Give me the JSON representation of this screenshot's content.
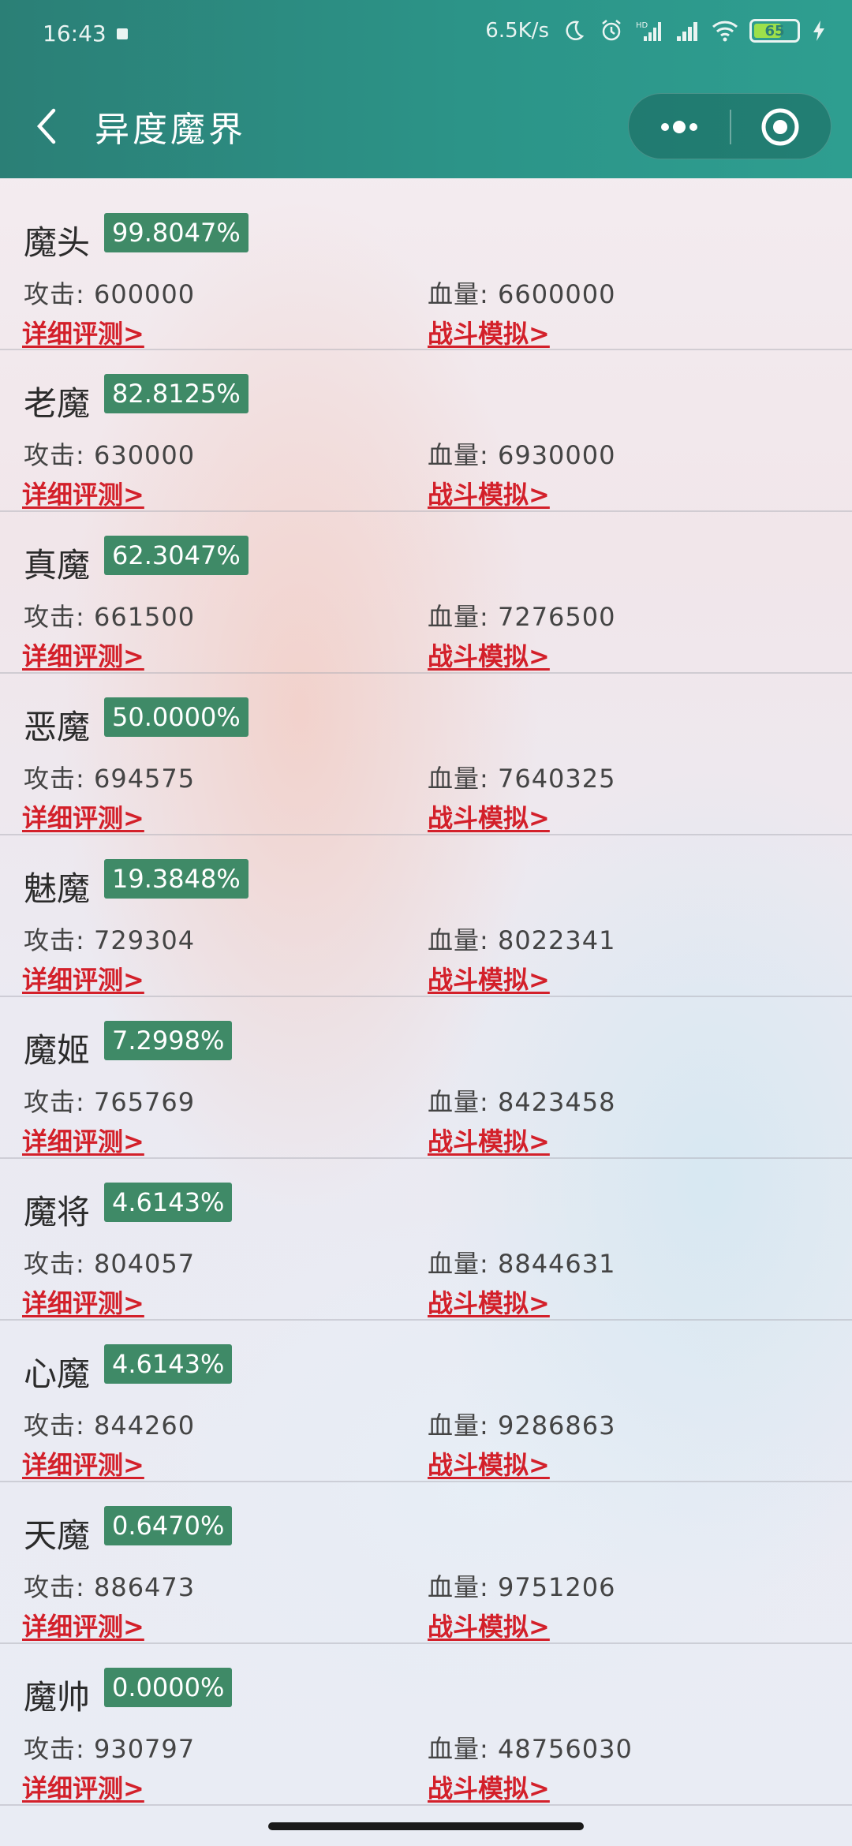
{
  "status_bar": {
    "time": "16:43",
    "network_speed": "6.5K/s",
    "battery_level": "65",
    "battery_fraction": 0.65,
    "icons": [
      "moon-icon",
      "alarm-icon",
      "hd-signal-icon",
      "signal-icon",
      "wifi-icon",
      "battery-icon",
      "charging-icon"
    ]
  },
  "header": {
    "title": "异度魔界",
    "back_icon": "chevron-left-icon",
    "more_icon": "more-dots-icon",
    "close_icon": "target-circle-icon"
  },
  "labels": {
    "attack": "攻击: ",
    "hp": "血量: ",
    "detail": "详细评测>",
    "battle": "战斗模拟>"
  },
  "colors": {
    "header": "#2c9488",
    "badge": "#3f8a67",
    "link": "#d3202a"
  },
  "monsters": [
    {
      "name": "魔头",
      "rate": "99.8047%",
      "attack": "600000",
      "hp": "6600000"
    },
    {
      "name": "老魔",
      "rate": "82.8125%",
      "attack": "630000",
      "hp": "6930000"
    },
    {
      "name": "真魔",
      "rate": "62.3047%",
      "attack": "661500",
      "hp": "7276500"
    },
    {
      "name": "恶魔",
      "rate": "50.0000%",
      "attack": "694575",
      "hp": "7640325"
    },
    {
      "name": "魅魔",
      "rate": "19.3848%",
      "attack": "729304",
      "hp": "8022341"
    },
    {
      "name": "魔姬",
      "rate": "7.2998%",
      "attack": "765769",
      "hp": "8423458"
    },
    {
      "name": "魔将",
      "rate": "4.6143%",
      "attack": "804057",
      "hp": "8844631"
    },
    {
      "name": "心魔",
      "rate": "4.6143%",
      "attack": "844260",
      "hp": "9286863"
    },
    {
      "name": "天魔",
      "rate": "0.6470%",
      "attack": "886473",
      "hp": "9751206"
    },
    {
      "name": "魔帅",
      "rate": "0.0000%",
      "attack": "930797",
      "hp": "48756030"
    }
  ]
}
